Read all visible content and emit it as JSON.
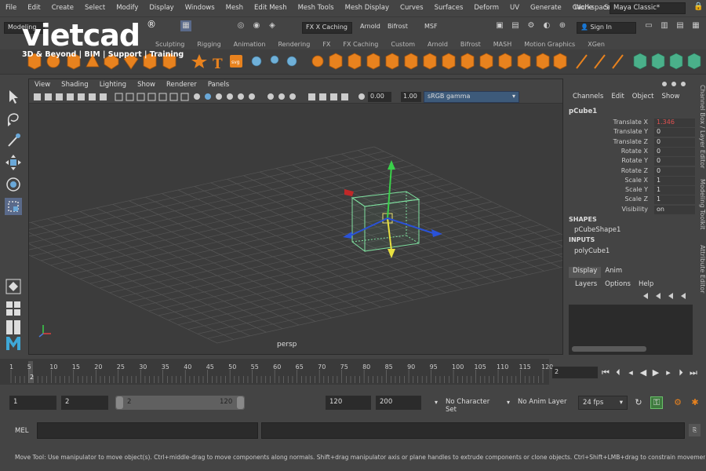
{
  "menubar": {
    "items": [
      "File",
      "Edit",
      "Create",
      "Select",
      "Modify",
      "Display",
      "Windows",
      "Mesh",
      "Edit Mesh",
      "Mesh Tools",
      "Mesh Display",
      "Curves",
      "Surfaces",
      "Deform",
      "UV",
      "Generate",
      "Cache",
      "Substance"
    ],
    "workspace_label": "Workspace :",
    "workspace_value": "Maya Classic*"
  },
  "statusline": {
    "mode": "Modeling",
    "caching": "FX X Caching",
    "renderer1": "Arnold",
    "renderer2": "Bifrost",
    "renderer3": "MSF",
    "sign_in": "Sign In"
  },
  "logo": {
    "name": "vietcad",
    "reg": "®",
    "tagline": "3D & Beyond | BIM | Support | Training"
  },
  "shelf": {
    "tabs": [
      "Sculpting",
      "Rigging",
      "Animation",
      "Rendering",
      "FX",
      "FX Caching",
      "Custom",
      "Arnold",
      "Bifrost",
      "MASH",
      "Motion Graphics",
      "XGen"
    ]
  },
  "viewport": {
    "menu": [
      "View",
      "Shading",
      "Lighting",
      "Show",
      "Renderer",
      "Panels"
    ],
    "exposure": "0.00",
    "gamma": "1.00",
    "colorspace": "sRGB gamma",
    "camera": "persp"
  },
  "channel_box": {
    "menu": [
      "Channels",
      "Edit",
      "Object",
      "Show"
    ],
    "object": "pCube1",
    "attributes": [
      {
        "name": "Translate X",
        "value": "1.346"
      },
      {
        "name": "Translate Y",
        "value": "0"
      },
      {
        "name": "Translate Z",
        "value": "0"
      },
      {
        "name": "Rotate X",
        "value": "0"
      },
      {
        "name": "Rotate Y",
        "value": "0"
      },
      {
        "name": "Rotate Z",
        "value": "0"
      },
      {
        "name": "Scale X",
        "value": "1"
      },
      {
        "name": "Scale Y",
        "value": "1"
      },
      {
        "name": "Scale Z",
        "value": "1"
      },
      {
        "name": "Visibility",
        "value": "on"
      }
    ],
    "shapes_label": "SHAPES",
    "shape_item": "pCubeShape1",
    "inputs_label": "INPUTS",
    "input_item": "polyCube1",
    "layer_tabs": [
      "Display",
      "Anim"
    ],
    "layer_menu": [
      "Layers",
      "Options",
      "Help"
    ]
  },
  "side_tabs": [
    "Channel Box / Layer Editor",
    "Modeling Toolkit",
    "Attribute Editor"
  ],
  "timeline": {
    "ticks": [
      "1",
      "2",
      "5",
      "10",
      "15",
      "20",
      "25",
      "30",
      "35",
      "40",
      "45",
      "50",
      "55",
      "60",
      "65",
      "70",
      "75",
      "80",
      "85",
      "90",
      "95",
      "100",
      "105",
      "110",
      "115",
      "120"
    ],
    "current_frame": "2",
    "playhead": "2"
  },
  "range": {
    "start": "1",
    "current": "2",
    "inner_start": "2",
    "inner_end": "120",
    "end": "120",
    "total_end": "200",
    "character_set": "No Character Set",
    "anim_layer": "No Anim Layer",
    "fps": "24 fps"
  },
  "command": {
    "label": "MEL"
  },
  "help": {
    "text": "Move Tool: Use manipulator to move object(s). Ctrl+middle-drag to move components along normals. Shift+drag manipulator axis or plane handles to extrude components or clone objects. Ctrl+Shift+LMB+drag to constrain movement to a connected edge. Use D or INSERT to change the pi"
  },
  "colors": {
    "accent_red": "#e84a4a",
    "translate_x_color": "#e05050",
    "orange_icons": "#e8821e",
    "cube_green": "#7fe0a0"
  }
}
